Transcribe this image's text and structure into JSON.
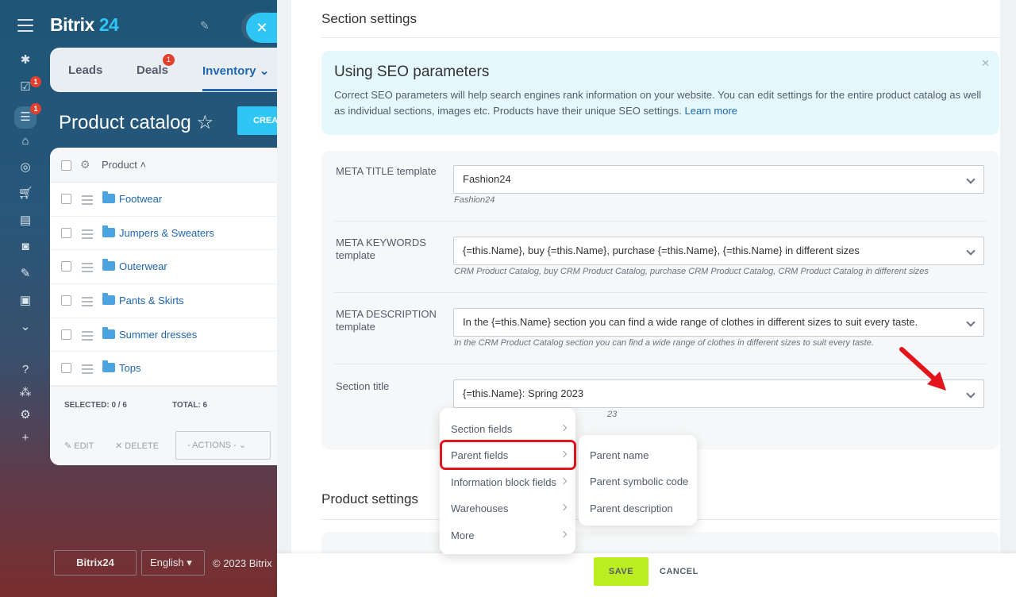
{
  "app": {
    "brand_main": "Bitrix",
    "brand_num": "24"
  },
  "leftbar": {
    "icons": [
      "menu-icon",
      "activity-icon",
      "tasks-icon",
      "filter-icon",
      "bank-icon",
      "target-icon",
      "cart-icon",
      "contact-card-icon",
      "robot-icon",
      "sign-icon",
      "box-icon",
      "chevron-circle-icon",
      "help-icon",
      "structure-icon",
      "settings-icon",
      "plus-icon"
    ],
    "badges": [
      "1",
      "1"
    ]
  },
  "topnav": {
    "tabs": [
      "Leads",
      "Deals",
      "Inventory"
    ],
    "deals_badge": "1"
  },
  "page": {
    "title": "Product catalog",
    "create_label": "CREA"
  },
  "grid": {
    "column": "Product",
    "rows": [
      "Footwear",
      "Jumpers & Sweaters",
      "Outerwear",
      "Pants & Skirts",
      "Summer dresses",
      "Tops"
    ],
    "selected_label": "SELECTED:",
    "selected_value": "0 / 6",
    "total_label": "TOTAL:",
    "total_value": "6",
    "edit": "EDIT",
    "delete": "DELETE",
    "actions": "- ACTIONS -"
  },
  "footer": {
    "bitrix": "Bitrix24",
    "lang": "English",
    "copy": "© 2023 Bitrix"
  },
  "slider": {
    "section_title": "Section settings",
    "alert": {
      "title": "Using SEO parameters",
      "body": "Correct SEO parameters will help search engines rank information on your website. You can edit settings for the entire product catalog as well as individual sections, images etc. Products have their unique SEO settings.",
      "link": "Learn more"
    },
    "fields": [
      {
        "label": "META TITLE template",
        "value": "Fashion24",
        "hint": "Fashion24"
      },
      {
        "label": "META KEYWORDS template",
        "value": "{=this.Name}, buy {=this.Name}, purchase {=this.Name}, {=this.Name} in different sizes",
        "hint": "CRM Product Catalog, buy CRM Product Catalog, purchase CRM Product Catalog, CRM Product Catalog in different sizes"
      },
      {
        "label": "META DESCRIPTION template",
        "value": "In the {=this.Name} section you can find a wide range of clothes in different sizes to suit every taste.",
        "hint": "In the CRM Product Catalog section you can find a wide range of clothes in different sizes to suit every taste."
      },
      {
        "label": "Section title",
        "value": "{=this.Name}: Spring 2023",
        "hint": "23"
      }
    ],
    "product_title": "Product settings",
    "save": "SAVE",
    "cancel": "CANCEL"
  },
  "menu": {
    "items": [
      "Section fields",
      "Parent fields",
      "Information block fields",
      "Warehouses",
      "More"
    ],
    "highlighted": "Parent fields",
    "submenu": [
      "Parent name",
      "Parent symbolic code",
      "Parent description"
    ]
  },
  "colors": {
    "accent": "#2fc6f6",
    "link": "#2067b0",
    "save": "#bbed21",
    "highlight": "#e3141c"
  }
}
